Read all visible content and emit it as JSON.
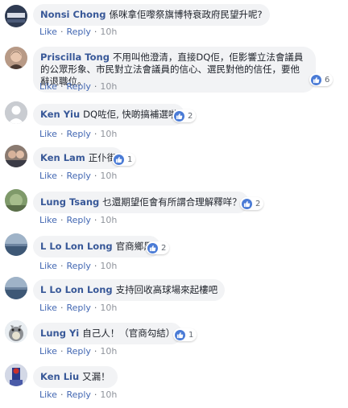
{
  "comments": [
    {
      "author": "Nonsi Chong",
      "text": "係咪拿佢嚟祭旗博特衰政府民望升呢?",
      "like_label": "Like",
      "reply_label": "Reply",
      "time": "10h",
      "reaction_count": null
    },
    {
      "author": "Priscilla Tong",
      "text": "不用叫他澄清，直接DQ佢，佢影響立法會議員的公眾形象、市民對立法會議員的信心、選民對他的信任，要他辭退職位。",
      "like_label": "Like",
      "reply_label": "Reply",
      "time": "10h",
      "reaction_count": "6"
    },
    {
      "author": "Ken Yiu",
      "text": "DQ咗佢, 快啲搞補選啦",
      "like_label": "Like",
      "reply_label": "Reply",
      "time": "10h",
      "reaction_count": "2"
    },
    {
      "author": "Ken Lam",
      "text": "正仆街",
      "like_label": "Like",
      "reply_label": "Reply",
      "time": "10h",
      "reaction_count": "1"
    },
    {
      "author": "Lung Tsang",
      "text": "乜還期望佢會有所謂合理解釋咩？",
      "like_label": "Like",
      "reply_label": "Reply",
      "time": "10h",
      "reaction_count": "2"
    },
    {
      "author": "L Lo Lon Long",
      "text": "官商鄉黑",
      "like_label": "Like",
      "reply_label": "Reply",
      "time": "10h",
      "reaction_count": "2"
    },
    {
      "author": "L Lo Lon Long",
      "text": "支持回收高球場來起樓吧",
      "like_label": "Like",
      "reply_label": "Reply",
      "time": "10h",
      "reaction_count": null
    },
    {
      "author": "Lung Yi",
      "text": "自己人！（官商勾結）",
      "like_label": "Like",
      "reply_label": "Reply",
      "time": "10h",
      "reaction_count": "1"
    },
    {
      "author": "Ken Liu",
      "text": "又漏！",
      "like_label": "Like",
      "reply_label": "Reply",
      "time": "10h",
      "reaction_count": null
    }
  ]
}
